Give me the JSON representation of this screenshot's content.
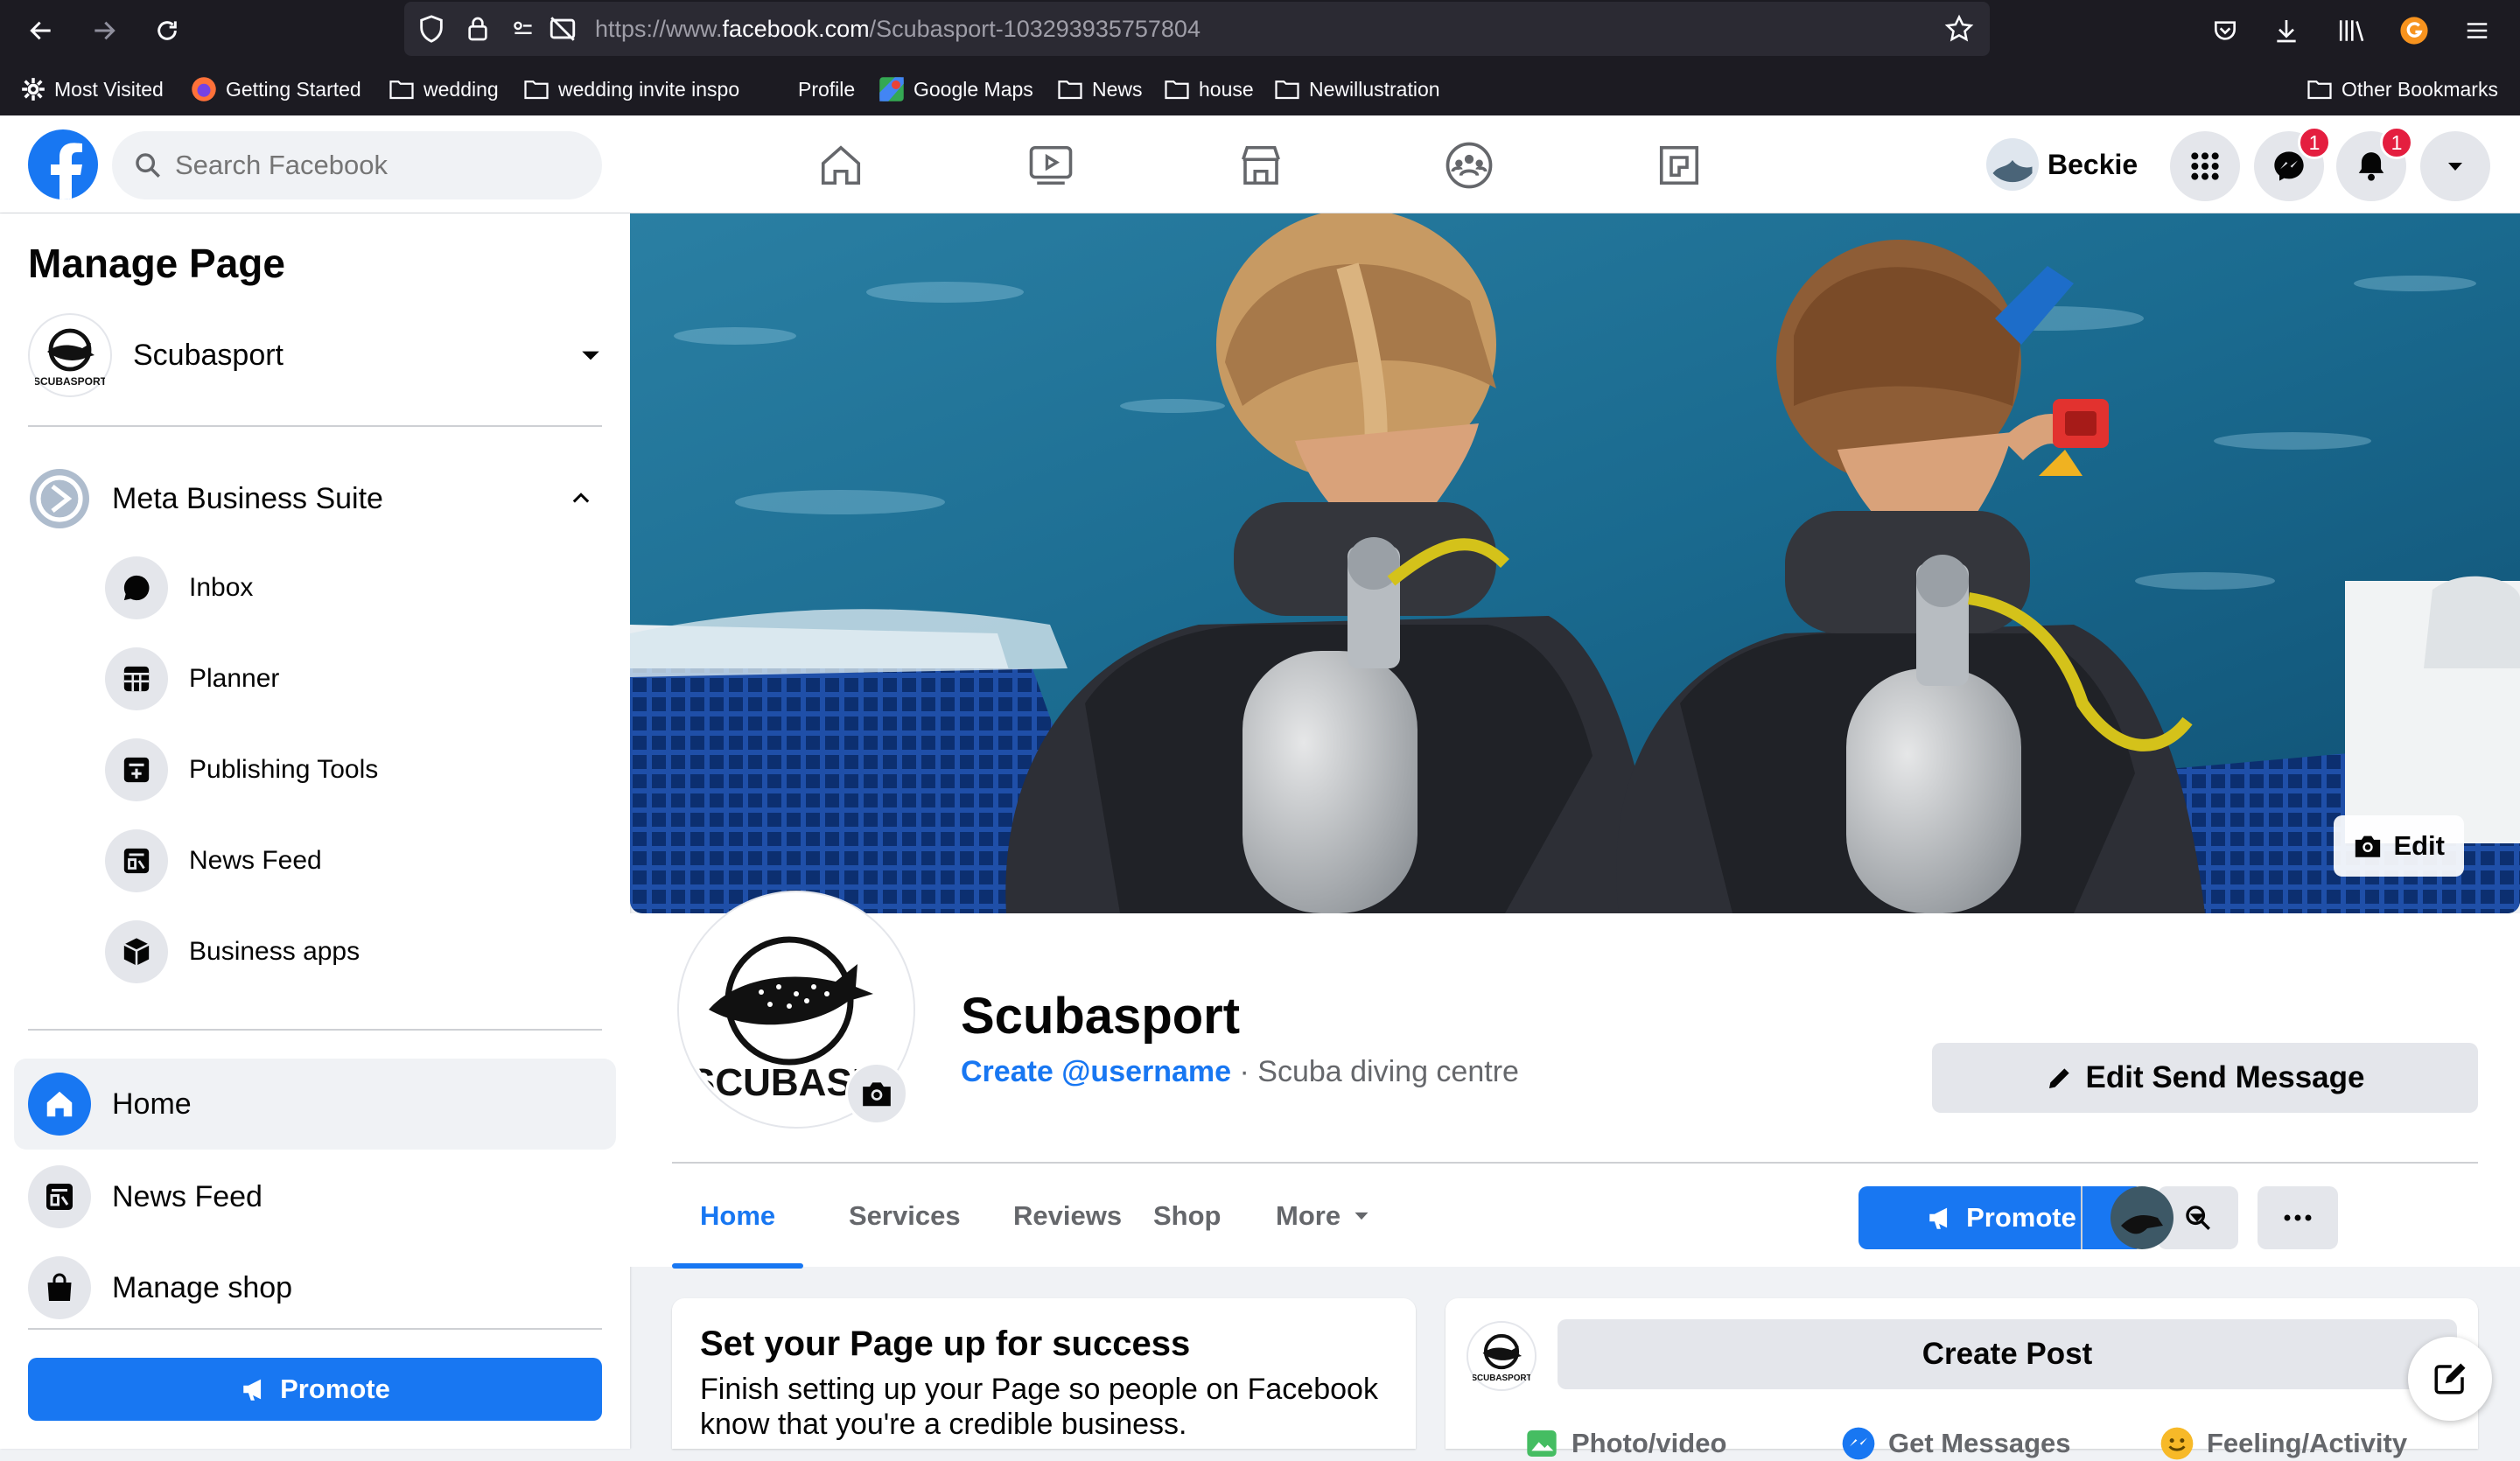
{
  "browser": {
    "url_prefix": "https://www.",
    "url_host": "facebook.com",
    "url_path": "/Scubasport-103293935757804",
    "bookmarks": [
      "Most Visited",
      "Getting Started",
      "wedding",
      "wedding invite inspo",
      "Profile",
      "Google Maps",
      "News",
      "house",
      "Newillustration"
    ],
    "other_bookmarks": "Other Bookmarks"
  },
  "topnav": {
    "search_placeholder": "Search Facebook",
    "user_name": "Beckie",
    "messenger_badge": "1",
    "notifications_badge": "1"
  },
  "sidebar": {
    "title": "Manage Page",
    "page_name": "Scubasport",
    "suite_label": "Meta Business Suite",
    "suite_items": [
      "Inbox",
      "Planner",
      "Publishing Tools",
      "News Feed",
      "Business apps"
    ],
    "main_items": [
      "Home",
      "News Feed",
      "Manage shop"
    ],
    "promote_label": "Promote"
  },
  "page": {
    "cover_edit_label": "Edit",
    "name": "Scubasport",
    "avatar_text": "SCUBASPORT",
    "username_link": "Create @username",
    "separator": " · ",
    "category": "Scuba diving centre",
    "edit_send_label": "Edit Send Message",
    "tabs": [
      "Home",
      "Services",
      "Reviews",
      "Shop",
      "More"
    ],
    "active_tab": "Home",
    "promote_label": "Promote"
  },
  "cards": {
    "success_title": "Set your Page up for success",
    "success_text": "Finish setting up your Page so people on Facebook know that you're a credible business.",
    "create_post_label": "Create Post",
    "actions": [
      "Photo/video",
      "Get Messages",
      "Feeling/Activity"
    ]
  },
  "colors": {
    "brand_blue": "#1877f2",
    "badge_red": "#e41e3f",
    "chrome_bg": "#1c1b22"
  }
}
